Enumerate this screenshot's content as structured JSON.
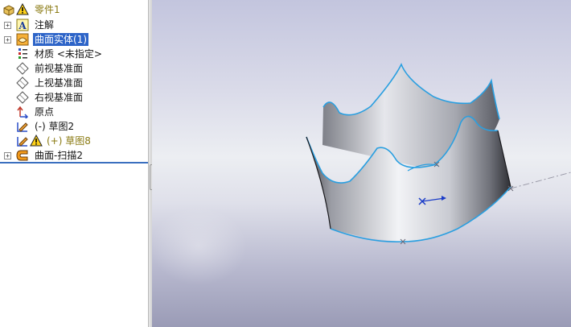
{
  "feature_tree": {
    "items": [
      {
        "label": "零件1",
        "icon": "part-icon",
        "expander": ""
      },
      {
        "label": "注解",
        "icon": "annotations-icon",
        "expander": "+"
      },
      {
        "label": "曲面实体(1)",
        "icon": "surface-bodies-icon",
        "expander": "+"
      },
      {
        "label": "材质 <未指定>",
        "icon": "material-icon",
        "expander": ""
      },
      {
        "label": "前视基准面",
        "icon": "plane-icon",
        "expander": ""
      },
      {
        "label": "上视基准面",
        "icon": "plane-icon",
        "expander": ""
      },
      {
        "label": "右视基准面",
        "icon": "plane-icon",
        "expander": ""
      },
      {
        "label": "原点",
        "icon": "origin-icon",
        "expander": ""
      },
      {
        "label": "(-) 草图2",
        "icon": "sketch-icon",
        "expander": ""
      },
      {
        "label": "(+) 草图8",
        "icon": "sketch-warning-icon",
        "expander": ""
      },
      {
        "label": "曲面-扫描2",
        "icon": "sweep-surface-icon",
        "expander": "+"
      }
    ]
  },
  "splitter": {
    "arrow_glyph": "‹"
  },
  "colors": {
    "selection": "#2d64c8",
    "warning_text": "#8a7a12",
    "edge_highlight": "#2a9fe0",
    "tree_separator": "#3a6fbf"
  }
}
